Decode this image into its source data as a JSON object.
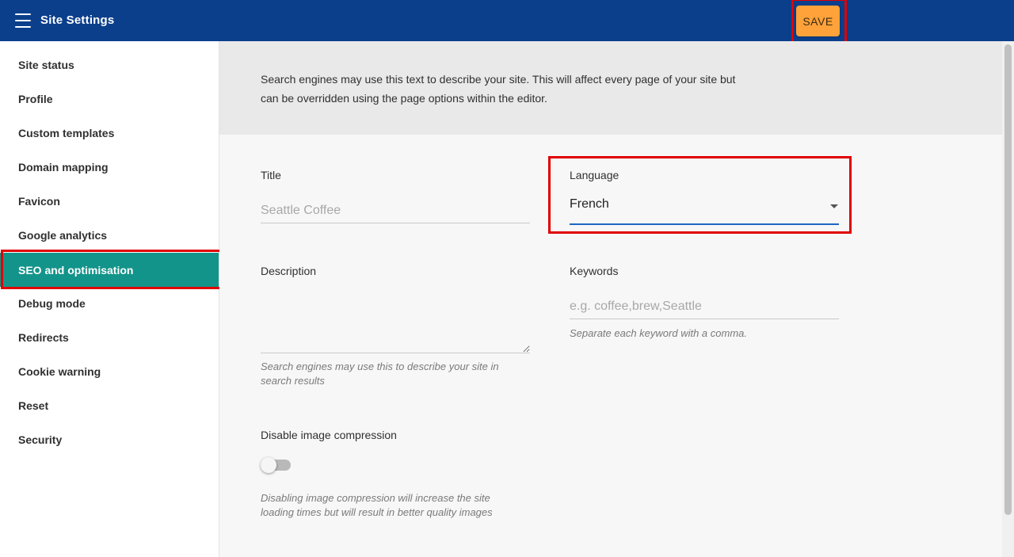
{
  "header": {
    "title": "Site Settings",
    "save_label": "SAVE",
    "background": "#0b3f8b",
    "save_color": "#ffa23a"
  },
  "sidebar": {
    "active_color": "#13948a",
    "items": [
      {
        "label": "Site status"
      },
      {
        "label": "Profile"
      },
      {
        "label": "Custom templates"
      },
      {
        "label": "Domain mapping"
      },
      {
        "label": "Favicon"
      },
      {
        "label": "Google analytics"
      },
      {
        "label": "SEO and optimisation",
        "active": true
      },
      {
        "label": "Debug mode"
      },
      {
        "label": "Redirects"
      },
      {
        "label": "Cookie warning"
      },
      {
        "label": "Reset"
      },
      {
        "label": "Security"
      }
    ]
  },
  "main": {
    "intro": "Search engines may use this text to describe your site. This will affect every page of your site but can be overridden using the page options within the editor.",
    "title_field": {
      "label": "Title",
      "value": "",
      "placeholder": "Seattle Coffee"
    },
    "language_field": {
      "label": "Language",
      "value": "French"
    },
    "description_field": {
      "label": "Description",
      "value": "",
      "hint": "Search engines may use this to describe your site in search results"
    },
    "keywords_field": {
      "label": "Keywords",
      "value": "",
      "placeholder": "e.g. coffee,brew,Seattle",
      "hint": "Separate each keyword with a comma."
    },
    "compression_field": {
      "label": "Disable image compression",
      "enabled": false,
      "hint": "Disabling image compression will increase the site loading times but will result in better quality images"
    }
  }
}
